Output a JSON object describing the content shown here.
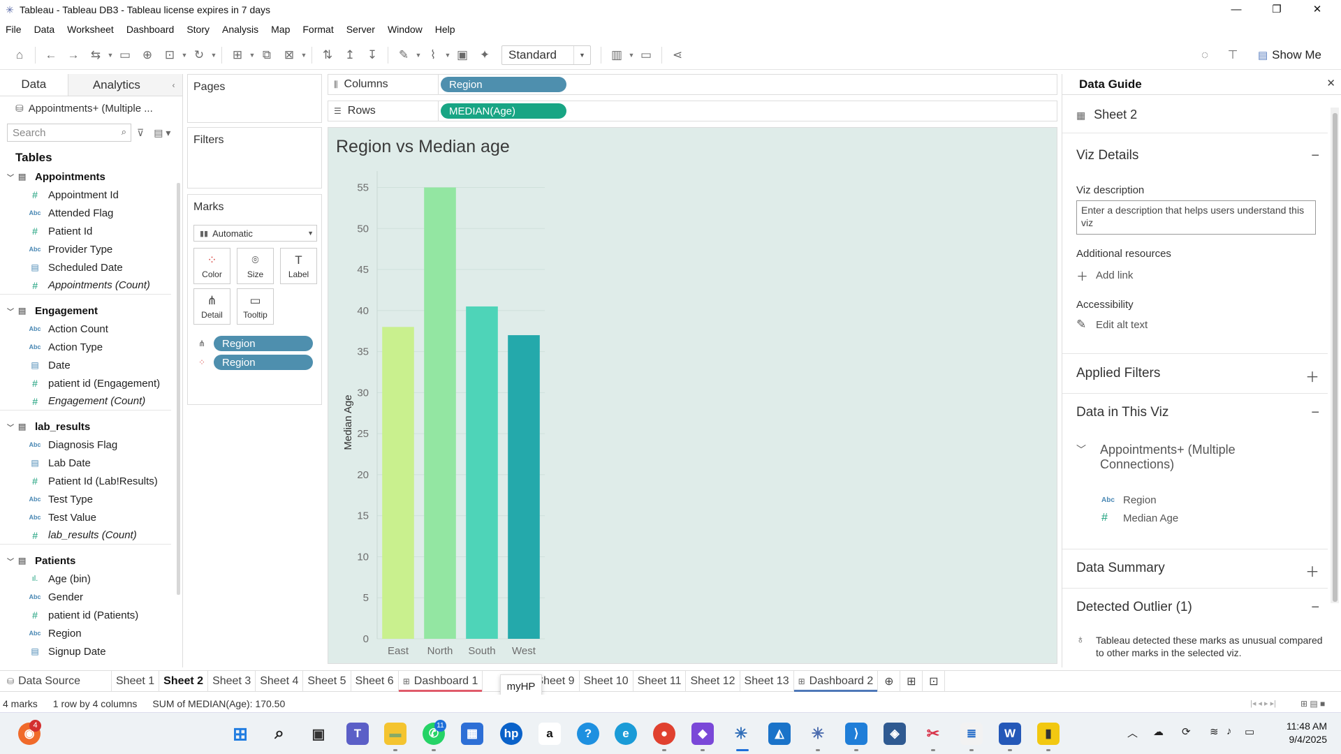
{
  "window": {
    "title": "Tableau - Tableau DB3 - Tableau license expires in 7 days",
    "controls": [
      "—",
      "❐",
      "✕"
    ]
  },
  "menu": [
    "File",
    "Data",
    "Worksheet",
    "Dashboard",
    "Story",
    "Analysis",
    "Map",
    "Format",
    "Server",
    "Window",
    "Help"
  ],
  "toolbar": {
    "fit": "Standard",
    "show_me": "Show Me"
  },
  "data_pane": {
    "tabs": [
      "Data",
      "Analytics"
    ],
    "datasource": "Appointments+ (Multiple ...",
    "search_placeholder": "Search",
    "tables_heading": "Tables",
    "groups": [
      {
        "name": "Appointments",
        "fields": [
          {
            "name": "Appointment Id",
            "type": "num"
          },
          {
            "name": "Attended Flag",
            "type": "abc"
          },
          {
            "name": "Patient Id",
            "type": "num"
          },
          {
            "name": "Provider Type",
            "type": "abc"
          },
          {
            "name": "Scheduled Date",
            "type": "dt"
          },
          {
            "name": "Appointments (Count)",
            "type": "num",
            "italic": true
          }
        ]
      },
      {
        "name": "Engagement",
        "fields": [
          {
            "name": "Action Count",
            "type": "abc"
          },
          {
            "name": "Action Type",
            "type": "abc"
          },
          {
            "name": "Date",
            "type": "dt"
          },
          {
            "name": "patient id (Engagement)",
            "type": "num"
          },
          {
            "name": "Engagement (Count)",
            "type": "num",
            "italic": true
          }
        ]
      },
      {
        "name": "lab_results",
        "fields": [
          {
            "name": "Diagnosis Flag",
            "type": "abc"
          },
          {
            "name": "Lab Date",
            "type": "dt"
          },
          {
            "name": "Patient Id (Lab!Results)",
            "type": "num"
          },
          {
            "name": "Test Type",
            "type": "abc"
          },
          {
            "name": "Test Value",
            "type": "abc"
          },
          {
            "name": "lab_results (Count)",
            "type": "num",
            "italic": true
          }
        ]
      },
      {
        "name": "Patients",
        "fields": [
          {
            "name": "Age (bin)",
            "type": "bin"
          },
          {
            "name": "Gender",
            "type": "abc"
          },
          {
            "name": "patient id (Patients)",
            "type": "num"
          },
          {
            "name": "Region",
            "type": "abc"
          },
          {
            "name": "Signup Date",
            "type": "dt"
          }
        ]
      }
    ]
  },
  "cards": {
    "pages": "Pages",
    "filters": "Filters",
    "marks": "Marks",
    "marks_type": "Automatic",
    "mark_buttons": [
      "Color",
      "Size",
      "Label",
      "Detail",
      "Tooltip"
    ],
    "mark_pills": [
      "Region",
      "Region"
    ]
  },
  "shelves": {
    "columns_label": "Columns",
    "rows_label": "Rows",
    "columns_pill": "Region",
    "rows_pill": "MEDIAN(Age)"
  },
  "chart_data": {
    "type": "bar",
    "title": "Region vs Median age",
    "xlabel": "",
    "ylabel": "Median Age",
    "categories": [
      "East",
      "North",
      "South",
      "West"
    ],
    "values": [
      38,
      55,
      40.5,
      37
    ],
    "ylim": [
      0,
      57
    ],
    "yticks": [
      0,
      5,
      10,
      15,
      20,
      25,
      30,
      35,
      40,
      45,
      50,
      55
    ],
    "colors": [
      "#c9f08e",
      "#93e6a2",
      "#4ed4b8",
      "#24a9ab"
    ],
    "grid": true,
    "background": "#dfece9"
  },
  "guide": {
    "title": "Data Guide",
    "sheet": "Sheet 2",
    "viz_details": "Viz Details",
    "viz_description_label": "Viz description",
    "viz_description_placeholder": "Enter a description that helps users understand this viz",
    "additional_resources": "Additional resources",
    "add_link": "Add link",
    "accessibility": "Accessibility",
    "edit_alt_text": "Edit alt text",
    "applied_filters": "Applied Filters",
    "data_in_viz": "Data in This Viz",
    "datasource_full": "Appointments+ (Multiple Connections)",
    "viz_fields": [
      "Region",
      "Median Age"
    ],
    "data_summary": "Data Summary",
    "detected_outlier": "Detected Outlier (1)",
    "outlier_text": "Tableau detected these marks as unusual compared to other marks in the selected viz."
  },
  "sheet_tabs": [
    "Data Source",
    "Sheet 1",
    "Sheet 2",
    "Sheet 3",
    "Sheet 4",
    "Sheet 5",
    "Sheet 6",
    "Dashboard 1",
    "Sheet 9",
    "Sheet 10",
    "Sheet 11",
    "Sheet 12",
    "Sheet 13",
    "Dashboard 2"
  ],
  "tooltip": "myHP",
  "status": {
    "marks": "4 marks",
    "dims": "1 row by 4 columns",
    "sum": "SUM of MEDIAN(Age): 170.50"
  },
  "taskbar": {
    "time": "11:48 AM",
    "date": "9/4/2025",
    "office_badge": "4",
    "whatsapp_badge": "11"
  }
}
